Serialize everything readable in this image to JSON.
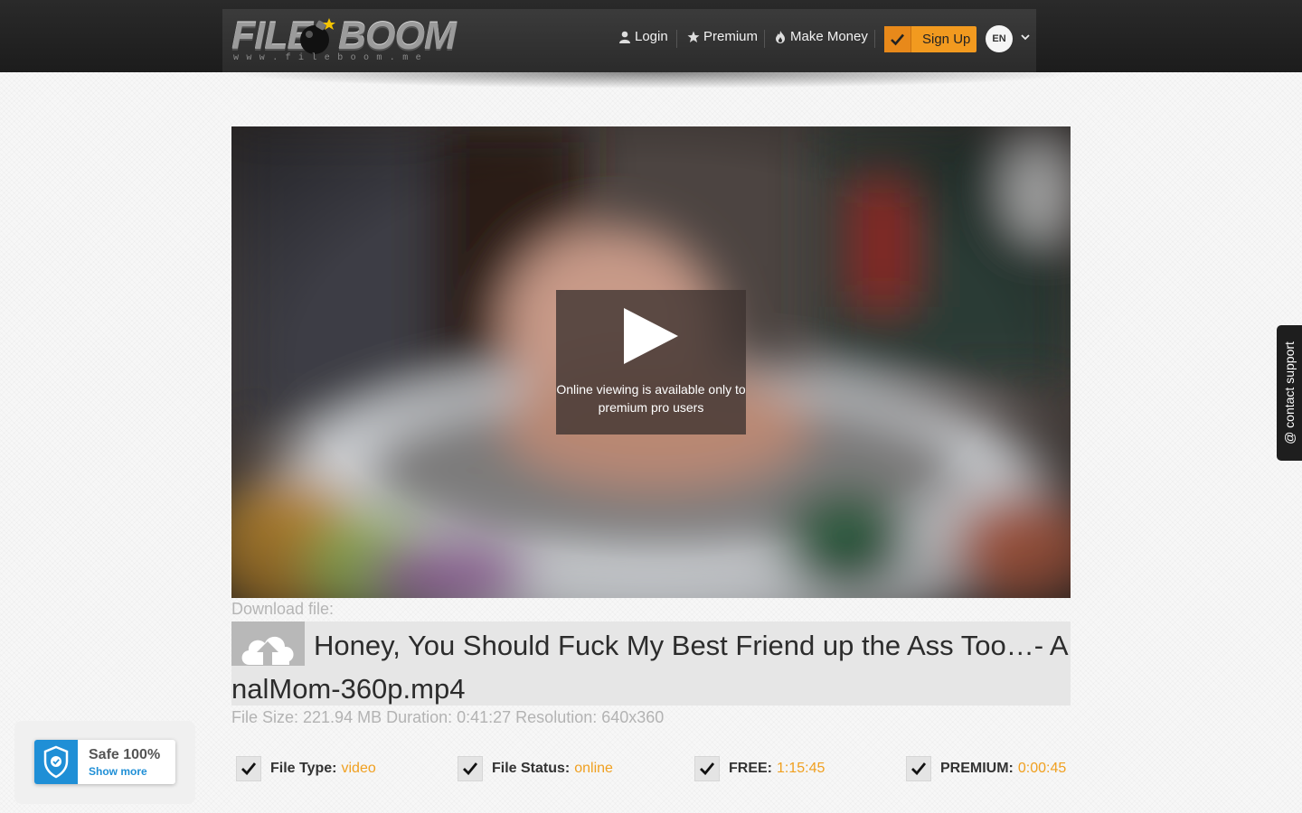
{
  "header": {
    "logo": {
      "word1": "FILE",
      "word2": "BOOM",
      "subtitle": "www.fileboom.me"
    },
    "nav": {
      "login": "Login",
      "premium": "Premium",
      "make_money": "Make Money",
      "sign_up": "Sign Up",
      "language": "EN"
    }
  },
  "player": {
    "message": "Online viewing is available only to premium pro users"
  },
  "file": {
    "download_label": "Download file:",
    "name": "Honey, You Should Fuck My Best Friend up the Ass Too…- AnalMom-360p.mp4",
    "size_text": "File Size: 221.94 MB",
    "duration_text": "Duration: 0:41:27",
    "resolution_text": "Resolution: 640x360"
  },
  "stats": {
    "file_type": {
      "label": "File Type:",
      "value": "video"
    },
    "file_status": {
      "label": "File Status:",
      "value": "online"
    },
    "free": {
      "label": "FREE:",
      "value": "1:15:45"
    },
    "premium": {
      "label": "PREMIUM:",
      "value": "0:00:45"
    }
  },
  "safe_badge": {
    "title": "Safe 100%",
    "link": "Show more"
  },
  "support_tab": {
    "label": "@ contact support"
  },
  "colors": {
    "accent_orange": "#f29a1f",
    "value_orange": "#f0a020",
    "badge_blue": "#1f8fd6"
  }
}
